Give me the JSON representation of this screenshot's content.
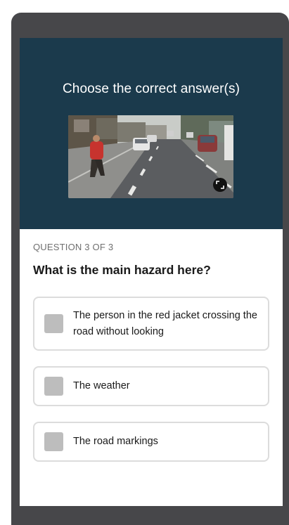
{
  "quiz": {
    "prompt": "Choose the correct answer(s)",
    "question_counter": "QUESTION 3 OF 3",
    "question": "What is the main hazard here?",
    "options": [
      {
        "label": "The person in the red jacket crossing the road without looking",
        "checked": false
      },
      {
        "label": "The weather",
        "checked": false
      },
      {
        "label": "The road markings",
        "checked": false
      }
    ]
  },
  "video": {
    "expand_icon": "expand-icon"
  },
  "colors": {
    "hero_background": "#1b3a4c",
    "frame": "#47474a",
    "checkbox_unchecked": "#bdbdbd",
    "option_border": "#dcdcdc"
  }
}
